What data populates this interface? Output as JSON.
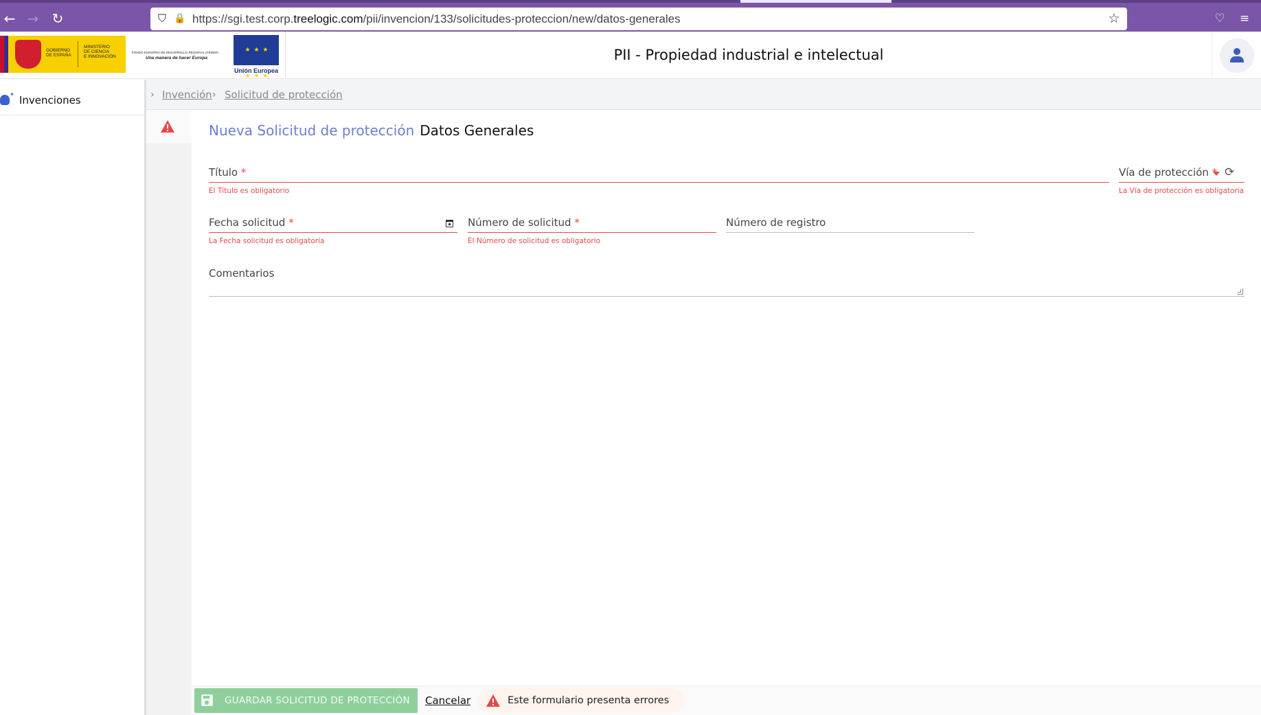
{
  "browser": {
    "url_prefix": "https://sgi.test.corp.",
    "url_domain": "treelogic.com",
    "url_path": "/pii/invencion/133/solicitudes-proteccion/new/datos-generales",
    "back_icon": "←",
    "forward_icon": "→",
    "reload_icon": "↻",
    "shield_icon": "⛉",
    "lock_icon": "🔒",
    "star_icon": "☆",
    "pocket_icon": "♡",
    "menu_icon": "≡"
  },
  "header": {
    "gob_text_1": "GOBIERNO\nDE ESPAÑA",
    "gob_text_2": "MINISTERIO\nDE CIENCIA\nE INNOVACIÓN",
    "feder_line1": "FONDO EUROPEO DE DESARROLLO REGIONAL (FEDER)",
    "feder_line2": "Una manera de hacer Europa",
    "eu_stars": "★ ★ ★ ★ ★ ★",
    "eu_caption": "Unión Europea",
    "title": "PII - Propiedad industrial e intelectual"
  },
  "sidebar": {
    "items": [
      {
        "label": "Invenciones"
      }
    ]
  },
  "breadcrumb": {
    "items": [
      {
        "label": "Invención"
      },
      {
        "label": "Solicitud de protección"
      }
    ]
  },
  "page": {
    "heading_highlight": "Nueva Solicitud de protección",
    "heading_section": "Datos Generales"
  },
  "form": {
    "titulo": {
      "label": "Título",
      "required": "*",
      "error": "El Título es obligatorio"
    },
    "via": {
      "label": "Vía de protección",
      "required": "*",
      "error": "La Vía de protección es obligatoria",
      "refresh_icon": "⟳"
    },
    "fecha": {
      "label": "Fecha solicitud",
      "required": "*",
      "error": "La Fecha solicitud es obligatoria"
    },
    "numero_solicitud": {
      "label": "Número de solicitud",
      "required": "*",
      "error": "El Número de solicitud es obligatorio"
    },
    "numero_registro": {
      "label": "Número de registro"
    },
    "comentarios": {
      "label": "Comentarios"
    }
  },
  "footer": {
    "save_label": "GUARDAR SOLICITUD DE PROTECCIÓN",
    "cancel_label": "Cancelar",
    "error_message": "Este formulario presenta errores"
  },
  "colors": {
    "browser_accent": "#7b55a8",
    "primary": "#6d7fce",
    "error": "#e24a4a",
    "save_button": "#8fcf9c"
  }
}
